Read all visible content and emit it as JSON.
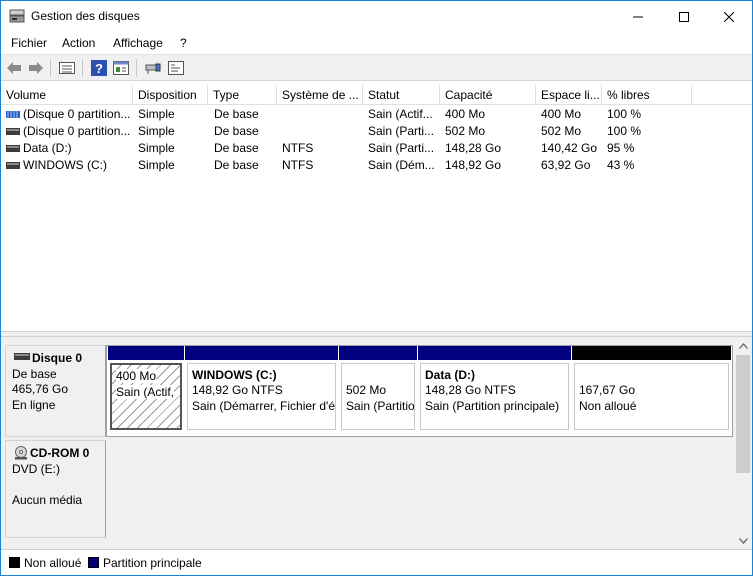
{
  "window": {
    "title": "Gestion des disques"
  },
  "menu": [
    "Fichier",
    "Action",
    "Affichage",
    "?"
  ],
  "toolbar": {
    "icons": [
      "back-arrow-icon",
      "forward-arrow-icon",
      "list-view-icon",
      "help-icon",
      "properties-icon",
      "connect-icon",
      "console-icon"
    ]
  },
  "columns": [
    "Volume",
    "Disposition",
    "Type",
    "Système de ...",
    "Statut",
    "Capacité",
    "Espace li...",
    "% libres"
  ],
  "volumes": [
    {
      "name": "(Disque 0 partition...",
      "layout": "Simple",
      "type": "De base",
      "fs": "",
      "status": "Sain (Actif...",
      "capacity": "400 Mo",
      "free": "400 Mo",
      "pct": "100 %",
      "icon": "volume-striped-icon"
    },
    {
      "name": "(Disque 0 partition...",
      "layout": "Simple",
      "type": "De base",
      "fs": "",
      "status": "Sain (Parti...",
      "capacity": "502 Mo",
      "free": "502 Mo",
      "pct": "100 %",
      "icon": "volume-icon"
    },
    {
      "name": "Data (D:)",
      "layout": "Simple",
      "type": "De base",
      "fs": "NTFS",
      "status": "Sain (Parti...",
      "capacity": "148,28 Go",
      "free": "140,42 Go",
      "pct": "95 %",
      "icon": "volume-icon"
    },
    {
      "name": "WINDOWS (C:)",
      "layout": "Simple",
      "type": "De base",
      "fs": "NTFS",
      "status": "Sain (Dém...",
      "capacity": "148,92 Go",
      "free": "63,92 Go",
      "pct": "43 %",
      "icon": "volume-icon"
    }
  ],
  "disk0": {
    "name": "Disque 0",
    "type": "De base",
    "size": "465,76 Go",
    "state": "En ligne",
    "partitions": [
      {
        "title": "",
        "size": "400 Mo",
        "status": "Sain (Actif,",
        "kind": "primary",
        "hatched": true
      },
      {
        "title": "WINDOWS  (C:)",
        "size": "148,92 Go NTFS",
        "status": "Sain (Démarrer, Fichier d'é",
        "kind": "primary",
        "hatched": false
      },
      {
        "title": "",
        "size": "502 Mo",
        "status": "Sain (Partitio",
        "kind": "primary",
        "hatched": false
      },
      {
        "title": "Data  (D:)",
        "size": "148,28 Go NTFS",
        "status": "Sain (Partition principale)",
        "kind": "primary",
        "hatched": false
      },
      {
        "title": "",
        "size": "167,67 Go",
        "status": "Non alloué",
        "kind": "unallocated",
        "hatched": false
      }
    ]
  },
  "cdrom0": {
    "name": "CD-ROM 0",
    "drive": "DVD (E:)",
    "media": "Aucun média"
  },
  "legend": [
    {
      "label": "Non alloué",
      "color": "#000000"
    },
    {
      "label": "Partition principale",
      "color": "#000080"
    }
  ],
  "colors": {
    "primary": "#000080",
    "unallocated": "#000000",
    "accent": "#1883d7"
  }
}
